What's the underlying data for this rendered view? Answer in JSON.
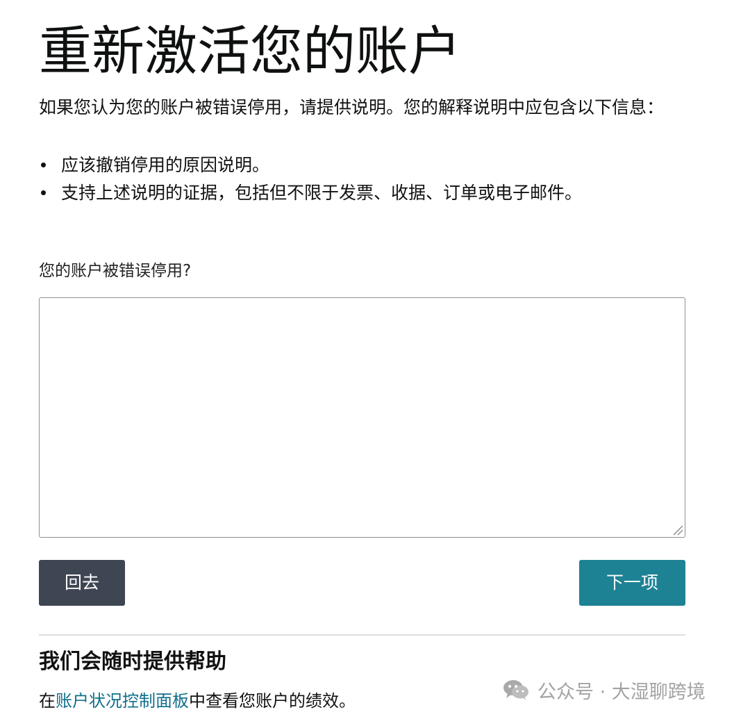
{
  "page": {
    "title": "重新激活您的账户",
    "intro": "如果您认为您的账户被错误停用，请提供说明。您的解释说明中应包含以下信息：",
    "requirements": [
      "应该撤销停用的原因说明。",
      "支持上述说明的证据，包括但不限于发票、收据、订单或电子邮件。"
    ],
    "question_label": "您的账户被错误停用?",
    "textarea_value": ""
  },
  "actions": {
    "back_label": "回去",
    "next_label": "下一项",
    "back_color": "#3f4653",
    "next_color": "#1e8295"
  },
  "help": {
    "title": "我们会随时提供帮助",
    "prefix": "在",
    "link_text": "账户状况控制面板",
    "suffix": "中查看您账户的绩效。",
    "link_color": "#0f6f8c"
  },
  "watermark": {
    "text": "公众号 · 大湿聊跨境",
    "icon": "wechat-icon"
  }
}
